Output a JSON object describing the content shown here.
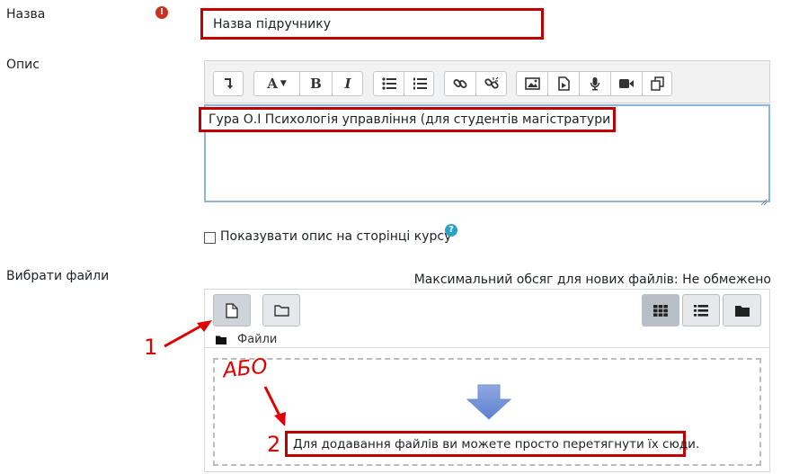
{
  "form": {
    "name_label": "Назва",
    "name_value": "Назва підручнику",
    "description_label": "Опис",
    "description_value": "Гура О.І Психологія управління (для студентів магістратури ... )",
    "show_description_label": "Показувати опис на сторінці курсу",
    "select_files_label": "Вибрати файли",
    "max_size_text": "Максимальний обсяг для нових файлів: Не обмежено"
  },
  "editor_toolbar": {
    "buttons": [
      "expand-toolbar-icon",
      "font-style-icon",
      "bold-icon",
      "italic-icon",
      "unordered-list-icon",
      "ordered-list-icon",
      "link-icon",
      "unlink-icon",
      "image-icon",
      "media-icon",
      "record-audio-icon",
      "record-video-icon",
      "manage-files-icon"
    ],
    "font_letter": "A",
    "bold_letter": "B",
    "italic_letter": "I"
  },
  "filepicker": {
    "path_label": "Файли",
    "drop_text": "Для додавання файлів ви можете просто перетягнути їх сюди.",
    "view_buttons": [
      "grid-view-icon",
      "list-view-icon",
      "tree-view-icon"
    ]
  },
  "annotations": {
    "arrow1_number": "1",
    "or_text": "АБО",
    "arrow2_number": "2"
  },
  "colors": {
    "required": "#ca3120",
    "highlight": "#c00000",
    "annotation": "#e00000",
    "focus_border": "#8ab6de",
    "help": "#2ba0c8",
    "drop_arrow": "#6f8fd4"
  }
}
